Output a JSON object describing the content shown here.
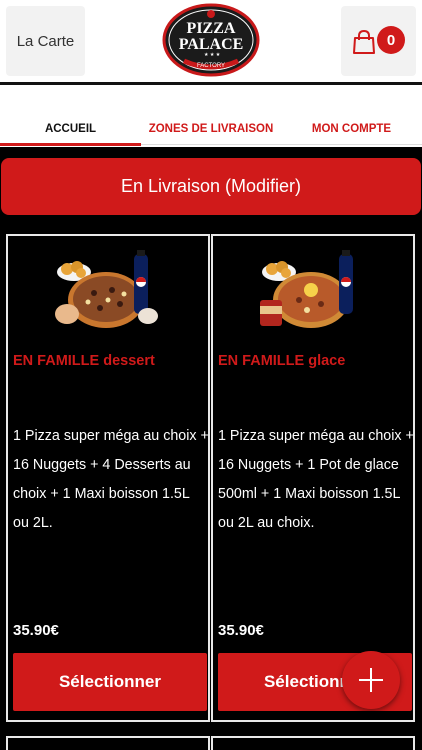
{
  "header": {
    "menu_label": "La Carte",
    "logo": {
      "line1": "PIZZA",
      "line2": "PALACE",
      "line3": "FACTORY"
    },
    "cart_count": "0"
  },
  "tabs": [
    {
      "label": "ACCUEIL",
      "active": true
    },
    {
      "label": "ZONES DE LIVRAISON",
      "active": false
    },
    {
      "label": "MON COMPTE",
      "active": false
    }
  ],
  "delivery": {
    "label": "En Livraison (Modifier)"
  },
  "products": [
    {
      "title": "EN FAMILLE dessert",
      "description": "1 Pizza super méga au choix + 16 Nuggets + 4 Desserts au choix + 1 Maxi boisson 1.5L ou 2L.",
      "price": "35.90€",
      "button_label": "Sélectionner"
    },
    {
      "title": "EN FAMILLE glace",
      "description": "1 Pizza super méga au choix + 16 Nuggets + 1 Pot de glace 500ml + 1 Maxi boisson 1.5L ou 2L au choix.",
      "price": "35.90€",
      "button_label": "Sélectionner"
    }
  ],
  "colors": {
    "brand_red": "#d01a1a",
    "background": "#000000"
  },
  "icons": {
    "cart": "shopping-bag-icon",
    "fab": "plus-icon"
  }
}
